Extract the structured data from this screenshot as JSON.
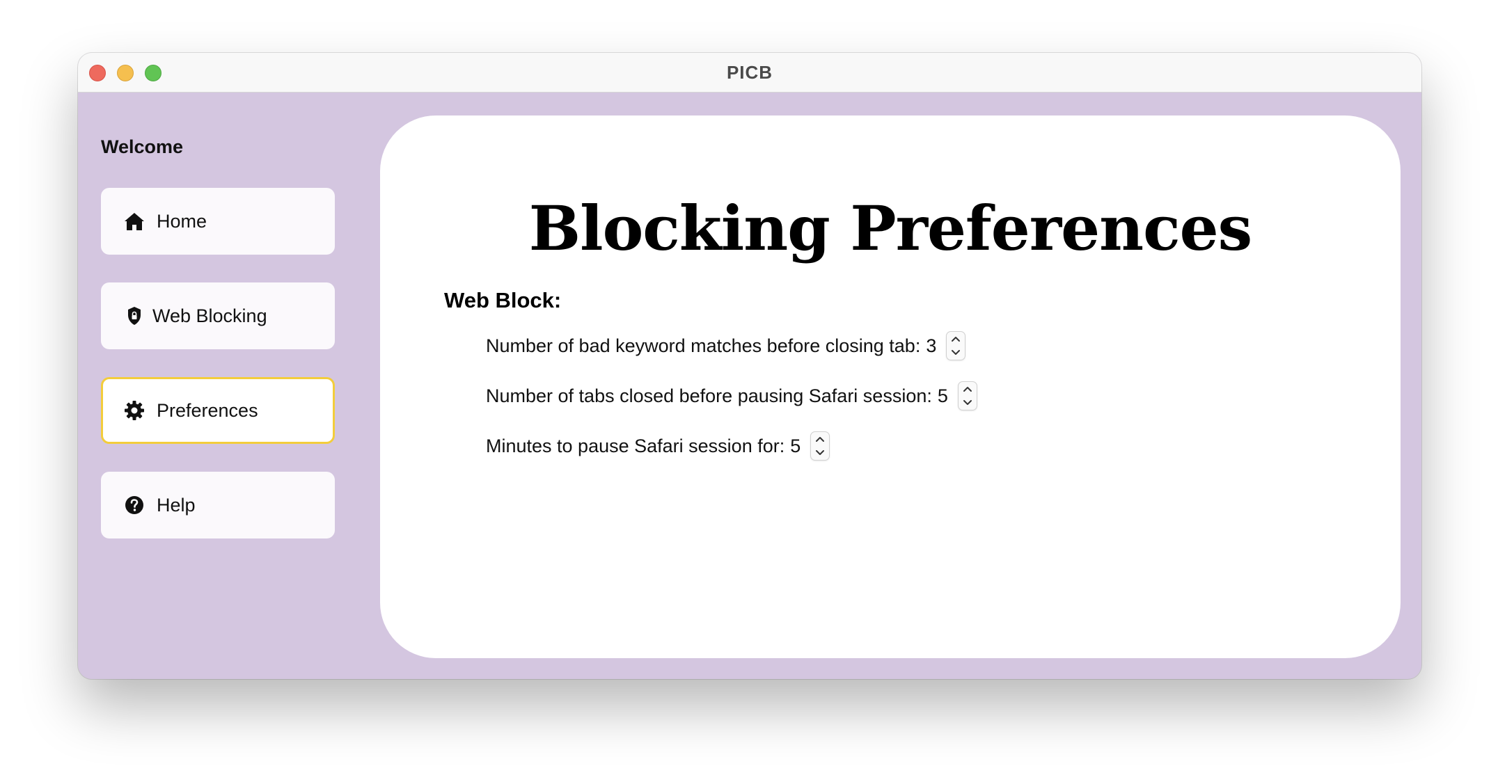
{
  "window": {
    "title": "PICB"
  },
  "sidebar": {
    "heading": "Welcome",
    "items": [
      {
        "label": "Home",
        "icon": "house-icon",
        "selected": false
      },
      {
        "label": "Web Blocking",
        "icon": "shield-lock-icon",
        "selected": false
      },
      {
        "label": "Preferences",
        "icon": "gear-icon",
        "selected": true
      },
      {
        "label": "Help",
        "icon": "question-circle-icon",
        "selected": false
      }
    ]
  },
  "main": {
    "title": "Blocking Preferences",
    "section": "Web Block:",
    "preferences": [
      {
        "label": "Number of bad keyword matches before closing tab:",
        "value": "3"
      },
      {
        "label": "Number of tabs closed before pausing Safari session:",
        "value": "5"
      },
      {
        "label": "Minutes to pause Safari session for:",
        "value": "5"
      }
    ]
  },
  "colors": {
    "sidebar_bg": "#d4c6e0",
    "selected_border": "#f3cd3b",
    "content_bg": "#ffffff"
  }
}
